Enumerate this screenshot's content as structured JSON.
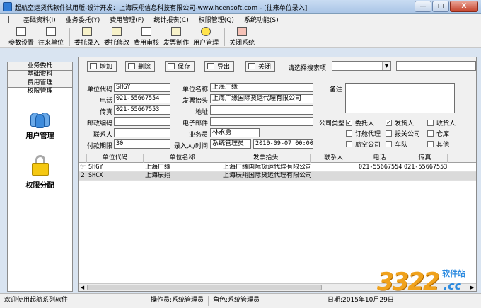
{
  "window": {
    "title": "起航空运货代软件试用版-设计开发：上海辰翔信息科技有限公司-www.hcensoft.com - [往来单位录入]",
    "minimize": "—",
    "maximize": "□",
    "close": "X"
  },
  "menu": [
    {
      "label": "基础资料(I)"
    },
    {
      "label": "业务委托(Y)"
    },
    {
      "label": "费用管理(F)"
    },
    {
      "label": "统计报表(C)"
    },
    {
      "label": "权限管理(Q)"
    },
    {
      "label": "系统功能(S)"
    }
  ],
  "toolbar": [
    {
      "label": "参数设置",
      "icon": "settings-icon"
    },
    {
      "label": "往来单位",
      "icon": "contacts-icon"
    },
    {
      "label": "委托录入",
      "icon": "entry-icon"
    },
    {
      "label": "委托修改",
      "icon": "edit-icon"
    },
    {
      "label": "费用审核",
      "icon": "audit-icon"
    },
    {
      "label": "发票制作",
      "icon": "invoice-icon"
    },
    {
      "label": "用户管理",
      "icon": "smiley-icon"
    },
    {
      "label": "关闭系统",
      "icon": "exit-icon"
    }
  ],
  "left_panel": {
    "tabs": [
      "业务委托",
      "基础资料",
      "费用管理",
      "权限管理"
    ],
    "entries": [
      {
        "label": "用户管理",
        "icon": "users-icon"
      },
      {
        "label": "权限分配",
        "icon": "lock-icon"
      }
    ]
  },
  "actions": {
    "add": "增加",
    "delete": "删除",
    "save": "保存",
    "export": "导出",
    "close": "关闭",
    "search_label": "请选择搜索项",
    "search_select_value": "",
    "search_arrow": "▼",
    "search_input_value": ""
  },
  "form": {
    "code_label": "单位代码",
    "code_value": "SHGY",
    "name_label": "单位名称",
    "name_value": "上海广缘",
    "remark_label": "备注",
    "phone_label": "电话",
    "phone_value": "021-55667554",
    "invoice_label": "发票抬头",
    "invoice_value": "上海广缘国际货运代理有限公司",
    "fax_label": "传真",
    "fax_value": "021-55667553",
    "address_label": "地址",
    "address_value": "",
    "zip_label": "邮政编码",
    "zip_value": "",
    "email_label": "电子邮件",
    "email_value": "",
    "company_type_label": "公司类型",
    "contact_label": "联系人",
    "contact_value": "",
    "salesman_label": "业务员",
    "salesman_value": "林永勇",
    "payterm_label": "付款期限",
    "payterm_value": "30",
    "recorder_label": "录入人/时间",
    "recorder_value": "系统管理员",
    "record_time_value": "2010-09-07 00:00:",
    "check_mark": "✓",
    "types": [
      {
        "label": "委托人",
        "checked": true
      },
      {
        "label": "发货人",
        "checked": true
      },
      {
        "label": "收货人",
        "checked": false
      },
      {
        "label": "订舱代理",
        "checked": false
      },
      {
        "label": "报关公司",
        "checked": false
      },
      {
        "label": "仓库",
        "checked": false
      },
      {
        "label": "航空公司",
        "checked": false
      },
      {
        "label": "车队",
        "checked": false
      },
      {
        "label": "其他",
        "checked": false
      }
    ]
  },
  "grid": {
    "columns": [
      "单位代码",
      "单位名称",
      "发票抬头",
      "联系人",
      "电话",
      "传真"
    ],
    "rows": [
      {
        "indicator": "☞",
        "code": "SHGY",
        "name": "上海广缘",
        "invoice": "上海广缘国际货运代理有限公司",
        "contact": "",
        "phone": "021-55667554",
        "fax": "021-55667553"
      },
      {
        "indicator": "2",
        "code": "SHCX",
        "name": "上海辰翔",
        "invoice": "上海辰翔国际货运代理有限公司",
        "contact": "",
        "phone": "",
        "fax": ""
      }
    ],
    "scroll_left": "◀",
    "scroll_right": "▶"
  },
  "status": {
    "welcome": "欢迎使用起航系列软件",
    "operator": "操作员:系统管理员",
    "role": "角色:系统管理员",
    "date": "日期:2015年10月29日"
  },
  "watermark": {
    "number": "3322",
    "site": "软件站",
    "domain": ".cc"
  }
}
